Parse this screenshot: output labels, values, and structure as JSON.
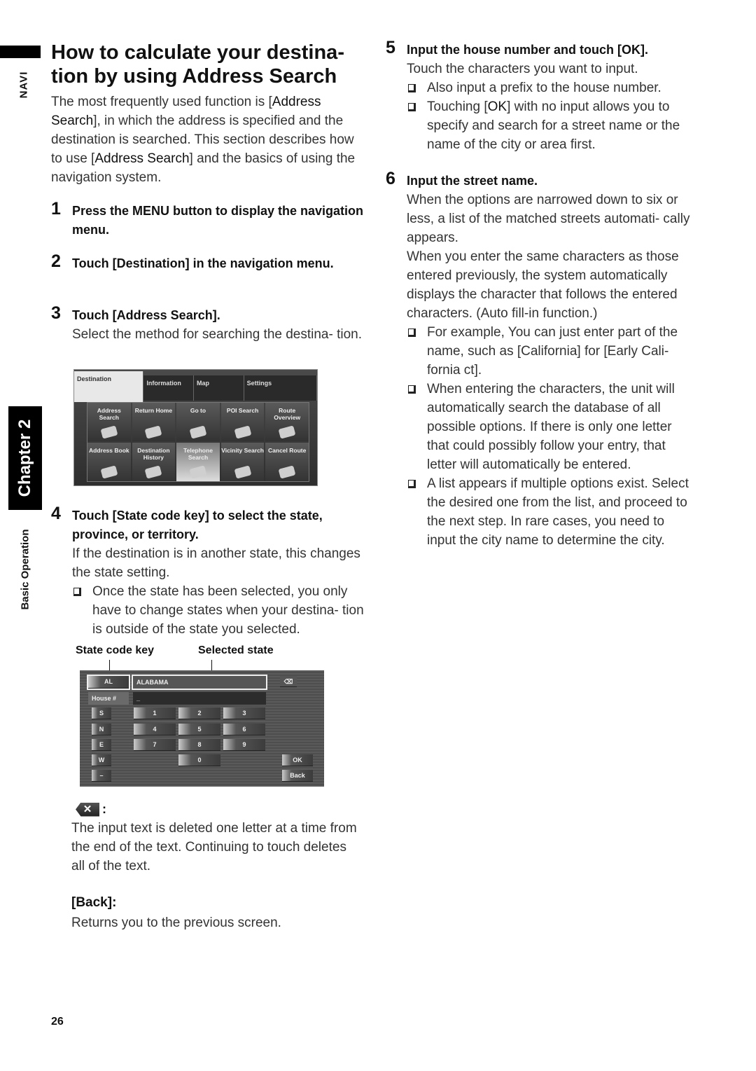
{
  "sidebar": {
    "navi": "NAVI",
    "chapter": "Chapter 2",
    "section": "Basic Operation"
  },
  "title": "How to calculate your destina- tion by using Address Search",
  "title_lines": [
    "How to calculate your destina-",
    "tion by using Address Search"
  ],
  "intro": {
    "t1": "The most frequently used function is [",
    "b1": "Address Search",
    "t2": "], in which the address is specified and the destination is searched. This section describes how to use [",
    "b2": "Address Search",
    "t3": "] and the basics of using the navigation system."
  },
  "steps": [
    {
      "num": "1",
      "head": "Press the MENU button to display the navigation menu."
    },
    {
      "num": "2",
      "head": "Touch [Destination] in the navigation menu."
    },
    {
      "num": "3",
      "head": "Touch [Address Search].",
      "body": "Select the method for searching the destina- tion."
    },
    {
      "num": "4",
      "head": "Touch [State code key] to select the state, province, or territory.",
      "body": "If the destination is in another state, this changes the state setting.",
      "bullets": [
        "Once the state has been selected, you only have to change states when your destina- tion is outside of the state you selected."
      ]
    },
    {
      "num": "5",
      "head": "Input the house number and touch [OK].",
      "body": "Touch the characters you want to input.",
      "bullets": [
        "Also input a prefix to the house number."
      ],
      "bullet2": {
        "t1": "Touching [",
        "b": "OK",
        "t2": "] with no input allows you to specify and search for a street name or the name of the city or area first."
      }
    },
    {
      "num": "6",
      "head": "Input the street name.",
      "body": "When the options are narrowed down to six or less, a list of the matched streets automati- cally appears.",
      "body2": "When you enter the same characters as those entered previously, the system automatically displays the character that follows the entered characters. (Auto fill-in function.)",
      "bullets": [
        "For example, You can just enter part of the name, such as [California] for [Early Cali- fornia ct].",
        "When entering the characters, the unit will automatically search the database of all possible options. If there is only one letter that could possibly follow your entry, that letter will automatically be entered.",
        "A list appears if multiple options exist. Select the desired one from the list, and proceed to the next step. In rare cases, you need to input the city name to determine the city."
      ]
    }
  ],
  "nav_menu_screen": {
    "tabs": [
      "Destination",
      "Information",
      "Map",
      "Settings"
    ],
    "active_tab": "Destination",
    "buttons": [
      "Address Search",
      "Return Home",
      "Go to",
      "POI Search",
      "Route Overview",
      "Address Book",
      "Destination History",
      "Telephone Search",
      "Vicinity Search",
      "Cancel Route"
    ]
  },
  "keypad_screen": {
    "labels": {
      "state_code_key": "State code key",
      "selected_state": "Selected state"
    },
    "state_code": "AL",
    "selected_state": "ALABAMA",
    "house_label": "House #",
    "house_value": "_",
    "delete_icon": "⌫",
    "direction_keys": [
      "S",
      "N",
      "E",
      "W",
      "–"
    ],
    "number_keys": [
      "1",
      "2",
      "3",
      "4",
      "5",
      "6",
      "7",
      "8",
      "9",
      "0"
    ],
    "ok_label": "OK",
    "back_label": "Back"
  },
  "notes": {
    "delete": {
      "icon": "✕",
      "colon": ":",
      "text": "The input text is deleted one letter at a time from the end of the text. Continuing to touch deletes all of the text."
    },
    "back": {
      "label": "[Back]:",
      "text": "Returns you to the previous screen."
    }
  },
  "page_number": "26"
}
